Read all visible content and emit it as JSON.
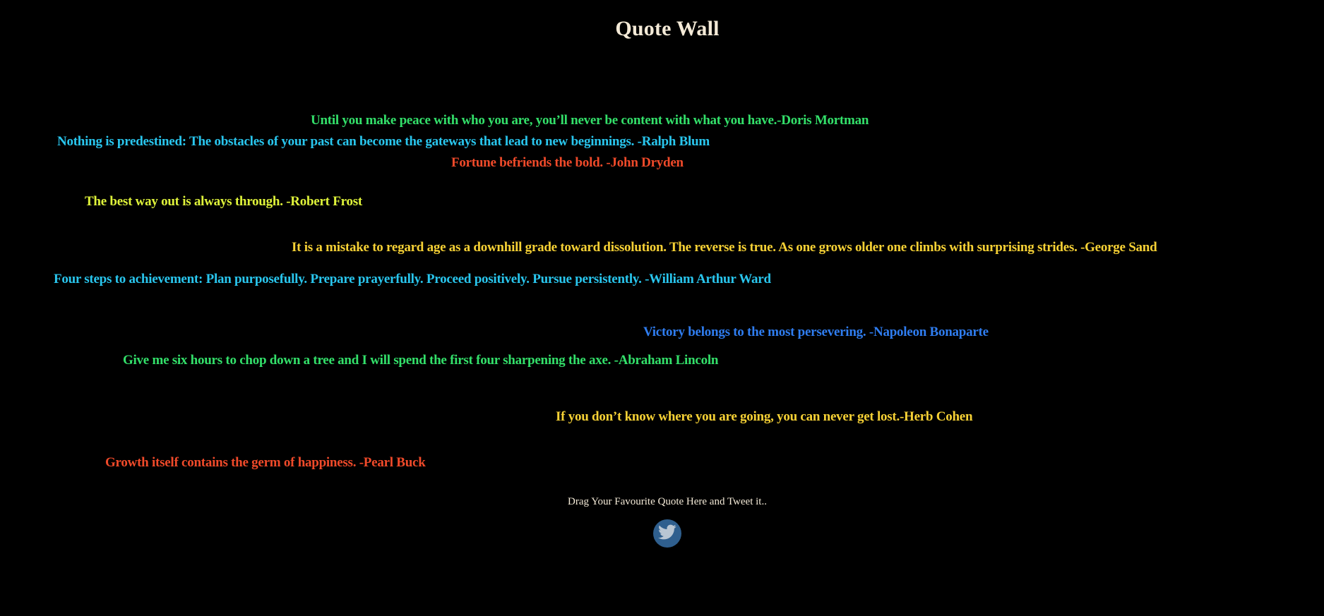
{
  "page": {
    "title": "Quote Wall"
  },
  "quotes": [
    {
      "text": "Until you make peace with who you are, you’ll never be content with what you have.-Doris Mortman",
      "color": "#33e06a"
    },
    {
      "text": "Nothing is predestined: The obstacles of your past can become the gateways that lead to new beginnings. -Ralph Blum",
      "color": "#29c6ee"
    },
    {
      "text": "Fortune befriends the bold. -John Dryden",
      "color": "#f04a2a"
    },
    {
      "text": "The best way out is always through. -Robert Frost",
      "color": "#dff33a"
    },
    {
      "text": "It is a mistake to regard age as a downhill grade toward dissolution. The reverse is true. As one grows older one climbs with surprising strides. -George Sand",
      "color": "#f6d135"
    },
    {
      "text": "Four steps to achievement: Plan purposefully. Prepare prayerfully. Proceed positively. Pursue persistently. -William Arthur Ward",
      "color": "#29c6ee"
    },
    {
      "text": "Victory belongs to the most persevering. -Napoleon Bonaparte",
      "color": "#2f7df0"
    },
    {
      "text": "Give me six hours to chop down a tree and I will spend the first four sharpening the axe. -Abraham Lincoln",
      "color": "#33e06a"
    },
    {
      "text": "If you don’t know where you are going, you can never get lost.-Herb Cohen",
      "color": "#f6d135"
    },
    {
      "text": "Growth itself contains the germ of happiness. -Pearl Buck",
      "color": "#f04a2a"
    }
  ],
  "dropzone": {
    "label": "Drag Your Favourite Quote Here and Tweet it..",
    "icon": "twitter-icon",
    "button_color": "#2f5f8e"
  }
}
